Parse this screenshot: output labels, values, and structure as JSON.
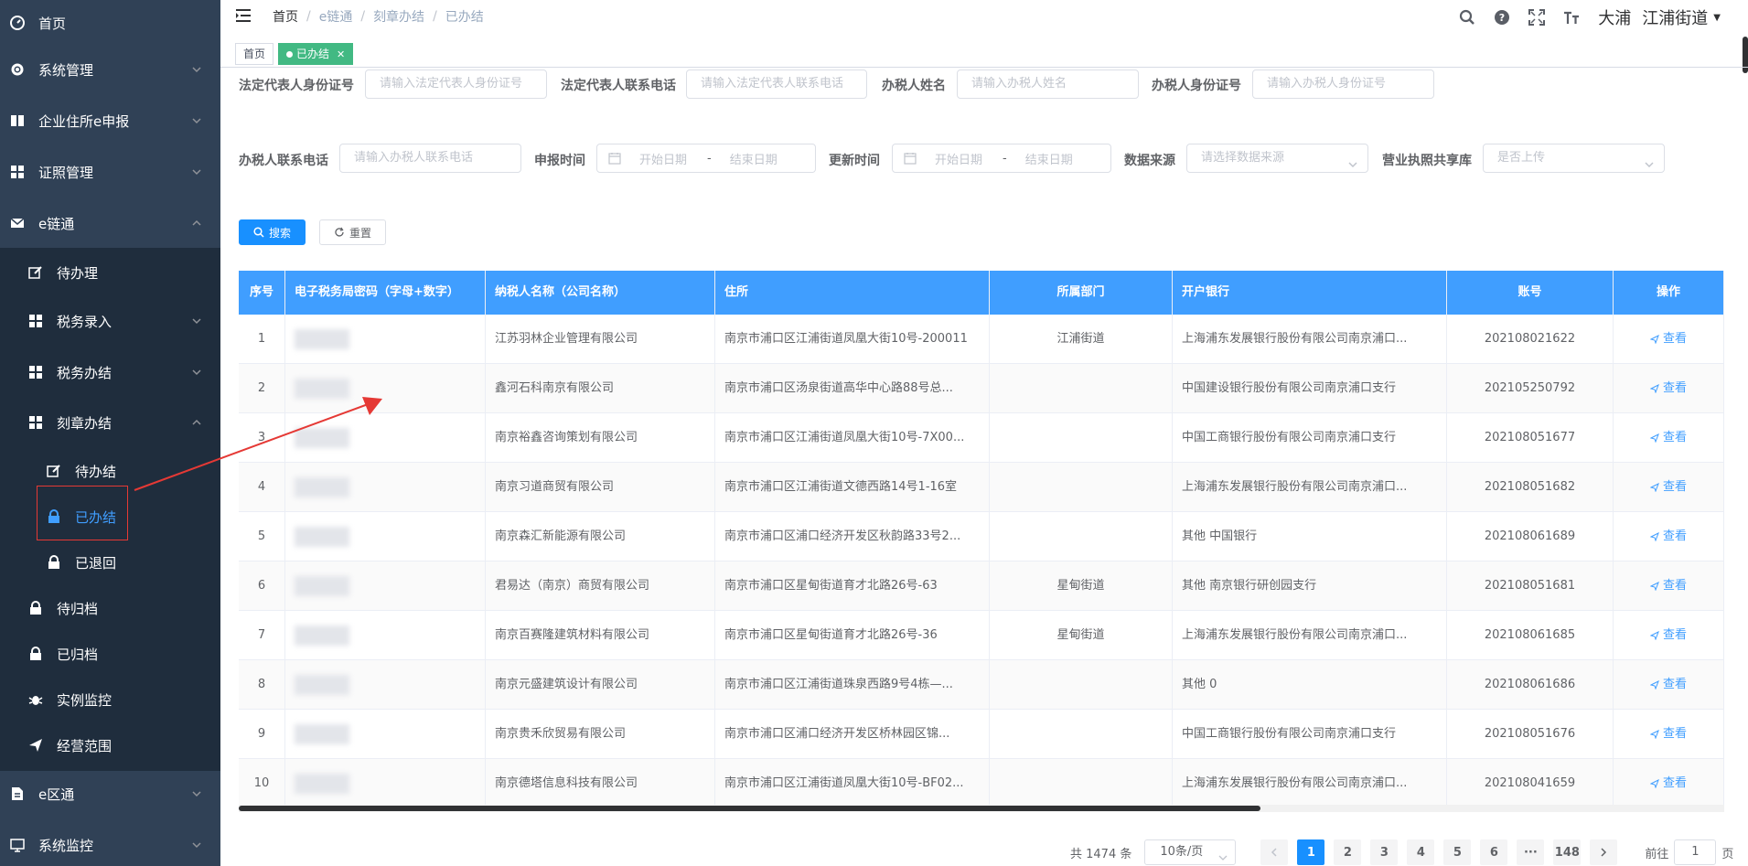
{
  "sidebar": {
    "items": [
      {
        "label": "首页",
        "icon": "dashboard-icon"
      },
      {
        "label": "系统管理",
        "icon": "gear-icon"
      },
      {
        "label": "企业住所e申报",
        "icon": "book-icon"
      },
      {
        "label": "证照管理",
        "icon": "grid-icon"
      },
      {
        "label": "e链通",
        "icon": "mail-icon"
      },
      {
        "label": "待办理",
        "icon": "edit-icon"
      },
      {
        "label": "税务录入",
        "icon": "grid-icon"
      },
      {
        "label": "税务办结",
        "icon": "grid-icon"
      },
      {
        "label": "刻章办结",
        "icon": "grid-icon"
      },
      {
        "label": "待办结",
        "icon": "edit-icon"
      },
      {
        "label": "已办结",
        "icon": "lock-icon"
      },
      {
        "label": "已退回",
        "icon": "lock-icon"
      },
      {
        "label": "待归档",
        "icon": "lock-icon"
      },
      {
        "label": "已归档",
        "icon": "lock-icon"
      },
      {
        "label": "实例监控",
        "icon": "bug-icon"
      },
      {
        "label": "经营范围",
        "icon": "send-icon"
      },
      {
        "label": "e区通",
        "icon": "document-icon"
      },
      {
        "label": "系统监控",
        "icon": "monitor-icon"
      }
    ]
  },
  "navbar": {
    "breadcrumb": [
      "首页",
      "e链通",
      "刻章办结",
      "已办结"
    ],
    "user_name": "大浦",
    "user_org": "江浦街道"
  },
  "tags": {
    "home": "首页",
    "active": "已办结"
  },
  "filters": {
    "legal_id_label": "法定代表人身份证号",
    "legal_id_placeholder": "请输入法定代表人身份证号",
    "legal_phone_label": "法定代表人联系电话",
    "legal_phone_placeholder": "请输入法定代表人联系电话",
    "taxer_name_label": "办税人姓名",
    "taxer_name_placeholder": "请输入办税人姓名",
    "taxer_id_label": "办税人身份证号",
    "taxer_id_placeholder": "请输入办税人身份证号",
    "taxer_phone_label": "办税人联系电话",
    "taxer_phone_placeholder": "请输入办税人联系电话",
    "apply_time_label": "申报时间",
    "update_time_label": "更新时间",
    "start_date_placeholder": "开始日期",
    "end_date_placeholder": "结束日期",
    "date_separator": "-",
    "source_label": "数据来源",
    "source_placeholder": "请选择数据来源",
    "license_share_label": "营业执照共享库",
    "license_share_placeholder": "是否上传"
  },
  "buttons": {
    "search": "搜索",
    "reset": "重置"
  },
  "table": {
    "headers": [
      "序号",
      "电子税务局密码（字母+数字）",
      "纳税人名称（公司名称）",
      "住所",
      "所属部门",
      "开户银行",
      "账号",
      "操作"
    ],
    "view_label": "查看",
    "rows": [
      {
        "no": "1",
        "name": "江苏羽林企业管理有限公司",
        "address": "南京市浦口区江浦街道凤凰大街10号-200011",
        "dept": "江浦街道",
        "bank": "上海浦东发展银行股份有限公司南京浦口...",
        "account": "202108021622"
      },
      {
        "no": "2",
        "name": "鑫河石科南京有限公司",
        "address": "南京市浦口区汤泉街道高华中心路88号总...",
        "dept": "",
        "bank": "中国建设银行股份有限公司南京浦口支行",
        "account": "202105250792"
      },
      {
        "no": "3",
        "name": "南京裕鑫咨询策划有限公司",
        "address": "南京市浦口区江浦街道凤凰大街10号-7X00...",
        "dept": "",
        "bank": "中国工商银行股份有限公司南京浦口支行",
        "account": "202108051677"
      },
      {
        "no": "4",
        "name": "南京习道商贸有限公司",
        "address": "南京市浦口区江浦街道文德西路14号1-16室",
        "dept": "",
        "bank": "上海浦东发展银行股份有限公司南京浦口...",
        "account": "202108051682"
      },
      {
        "no": "5",
        "name": "南京森汇新能源有限公司",
        "address": "南京市浦口区浦口经济开发区秋韵路33号2...",
        "dept": "",
        "bank": "其他  中国银行",
        "account": "202108061689"
      },
      {
        "no": "6",
        "name": "君易达（南京）商贸有限公司",
        "address": "南京市浦口区星甸街道育才北路26号-63",
        "dept": "星甸街道",
        "bank": "其他  南京银行研创园支行",
        "account": "202108051681"
      },
      {
        "no": "7",
        "name": "南京百赛隆建筑材料有限公司",
        "address": "南京市浦口区星甸街道育才北路26号-36",
        "dept": "星甸街道",
        "bank": "上海浦东发展银行股份有限公司南京浦口...",
        "account": "202108061685"
      },
      {
        "no": "8",
        "name": "南京元盛建筑设计有限公司",
        "address": "南京市浦口区江浦街道珠泉西路9号4栋—...",
        "dept": "",
        "bank": "其他  0",
        "account": "202108061686"
      },
      {
        "no": "9",
        "name": "南京贵禾欣贸易有限公司",
        "address": "南京市浦口区浦口经济开发区桥林园区锦...",
        "dept": "",
        "bank": "中国工商银行股份有限公司南京浦口支行",
        "account": "202108051676"
      },
      {
        "no": "10",
        "name": "南京德塔信息科技有限公司",
        "address": "南京市浦口区江浦街道凤凰大街10号-BF02...",
        "dept": "",
        "bank": "上海浦东发展银行股份有限公司南京浦口...",
        "account": "202108041659"
      }
    ]
  },
  "pagination": {
    "total": "共 1474 条",
    "page_size": "10条/页",
    "pages": [
      "1",
      "2",
      "3",
      "4",
      "5",
      "6",
      "···",
      "148"
    ],
    "current": "1",
    "jump_prefix": "前往",
    "jump_value": "1",
    "jump_suffix": "页"
  },
  "colors": {
    "sidebar_bg": "#304156",
    "submenu_bg": "#1f2d3d",
    "primary": "#409eff",
    "tag_active": "#42b983",
    "annotation": "#e53935"
  }
}
